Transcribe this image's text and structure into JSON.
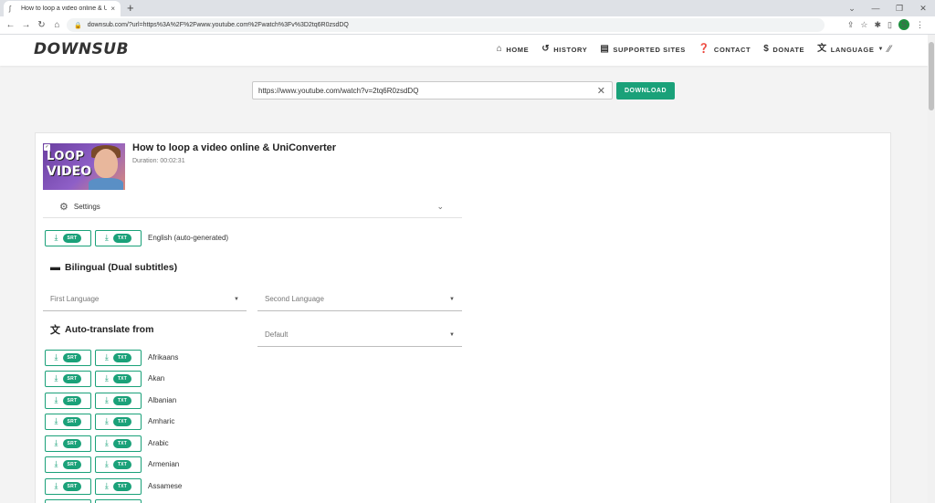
{
  "browser": {
    "tab_title": "How to loop a video online & Un",
    "tab_close": "×",
    "new_tab": "+",
    "url": "downsub.com/?url=https%3A%2F%2Fwww.youtube.com%2Fwatch%3Fv%3D2tq6R0zsdDQ",
    "profile_initial": "S",
    "icons": [
      "back-icon",
      "forward-icon",
      "reload-icon",
      "home-icon",
      "lock-icon",
      "share-icon",
      "star-icon",
      "extensions-icon",
      "sidepanel-icon",
      "menu-icon"
    ]
  },
  "site": {
    "logo": "DOWNSUB",
    "nav": [
      {
        "label": "HOME",
        "icon": "home-icon"
      },
      {
        "label": "HISTORY",
        "icon": "history-icon"
      },
      {
        "label": "SUPPORTED SITES",
        "icon": "list-icon"
      },
      {
        "label": "CONTACT",
        "icon": "help-icon"
      },
      {
        "label": "DONATE",
        "icon": "dollar-icon"
      },
      {
        "label": "LANGUAGE",
        "icon": "translate-icon"
      }
    ]
  },
  "search": {
    "value": "https://www.youtube.com/watch?v=2tq6R0zsdDQ",
    "button": "DOWNLOAD"
  },
  "video": {
    "thumb_text_1": "LOOP",
    "thumb_text_2": "VIDEO",
    "title": "How to loop a video online & UniConverter",
    "duration": "Duration: 00:02:31"
  },
  "settings_label": "Settings",
  "formats": {
    "srt": "SRT",
    "txt": "TXT"
  },
  "original": {
    "language": "English (auto-generated)"
  },
  "bilingual": {
    "heading": "Bilingual (Dual subtitles)",
    "first_language": "First Language",
    "second_language": "Second Language",
    "default": "Default"
  },
  "auto_translate": {
    "heading": "Auto-translate from",
    "languages": [
      "Afrikaans",
      "Akan",
      "Albanian",
      "Amharic",
      "Arabic",
      "Armenian",
      "Assamese"
    ]
  },
  "colors": {
    "accent": "#1aa179"
  }
}
